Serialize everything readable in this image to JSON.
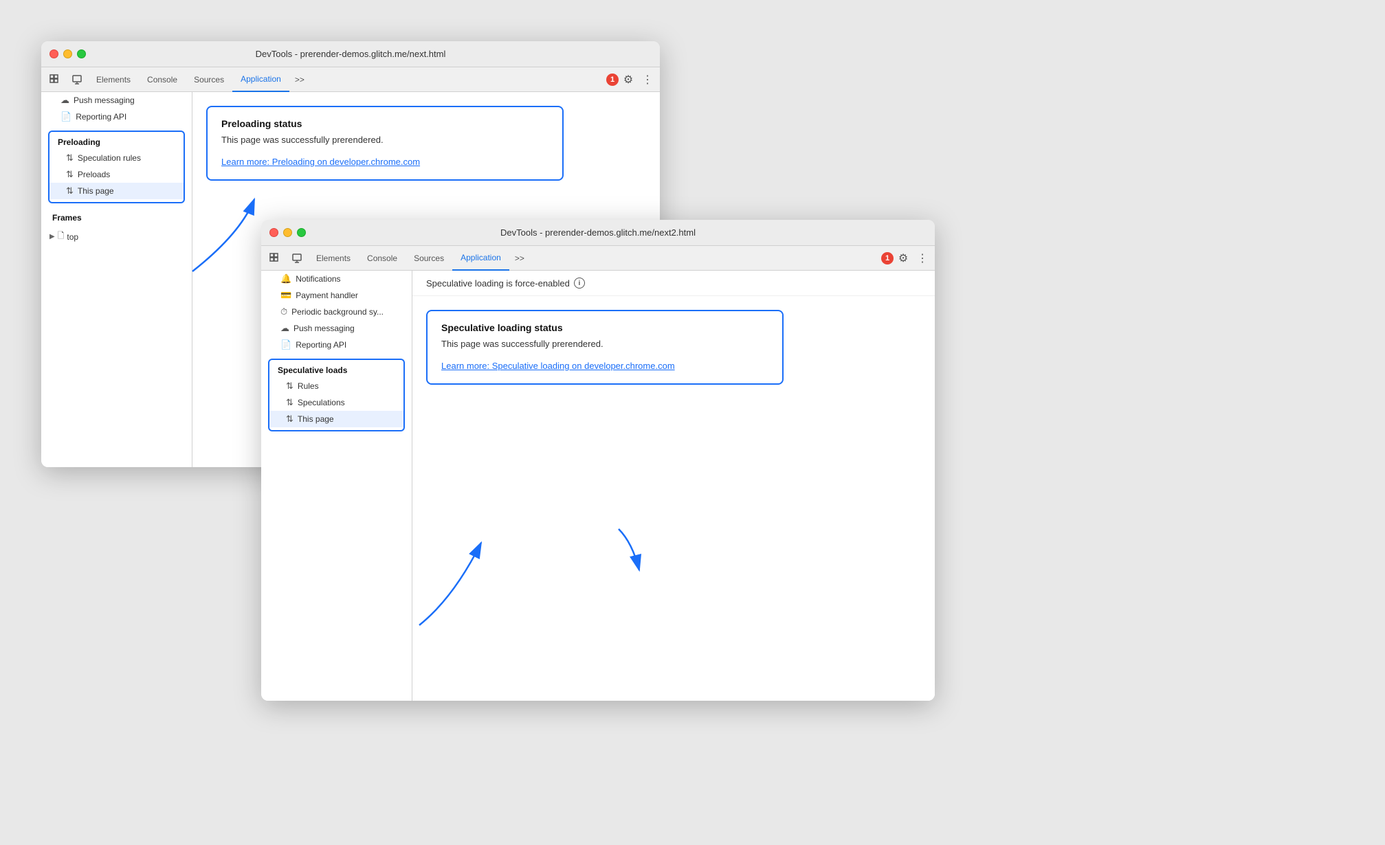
{
  "window1": {
    "title": "DevTools - prerender-demos.glitch.me/next.html",
    "tabs": [
      {
        "label": "Elements",
        "active": false
      },
      {
        "label": "Console",
        "active": false
      },
      {
        "label": "Sources",
        "active": false
      },
      {
        "label": "Application",
        "active": true
      }
    ],
    "tab_more": ">>",
    "error_count": "1",
    "sidebar": {
      "sidebar_items_above": [
        {
          "icon": "☁",
          "label": "Push messaging"
        },
        {
          "icon": "📄",
          "label": "Reporting API"
        }
      ],
      "preloading_header": "Preloading",
      "preloading_items": [
        {
          "icon": "⇅",
          "label": "Speculation rules",
          "selected": false
        },
        {
          "icon": "⇅",
          "label": "Preloads",
          "selected": false
        },
        {
          "icon": "⇅",
          "label": "This page",
          "selected": true
        }
      ],
      "frames_header": "Frames",
      "frames_top": "top"
    },
    "main": {
      "preloading_status_title": "Preloading status",
      "preloading_status_desc": "This page was successfully prerendered.",
      "preloading_status_link": "Learn more: Preloading on developer.chrome.com"
    }
  },
  "window2": {
    "title": "DevTools - prerender-demos.glitch.me/next2.html",
    "tabs": [
      {
        "label": "Elements",
        "active": false
      },
      {
        "label": "Console",
        "active": false
      },
      {
        "label": "Sources",
        "active": false
      },
      {
        "label": "Application",
        "active": true
      }
    ],
    "tab_more": ">>",
    "error_count": "1",
    "sidebar": {
      "sidebar_items": [
        {
          "icon": "🔔",
          "label": "Notifications"
        },
        {
          "icon": "💳",
          "label": "Payment handler"
        },
        {
          "icon": "⏱",
          "label": "Periodic background sy..."
        },
        {
          "icon": "☁",
          "label": "Push messaging"
        },
        {
          "icon": "📄",
          "label": "Reporting API"
        }
      ],
      "spec_loads_header": "Speculative loads",
      "spec_loads_items": [
        {
          "icon": "⇅",
          "label": "Rules",
          "selected": false
        },
        {
          "icon": "⇅",
          "label": "Speculations",
          "selected": false
        },
        {
          "icon": "⇅",
          "label": "This page",
          "selected": true
        }
      ]
    },
    "info_bar": {
      "text": "Speculative loading is force-enabled",
      "icon": "i"
    },
    "main": {
      "spec_status_title": "Speculative loading status",
      "spec_status_desc": "This page was successfully prerendered.",
      "spec_status_link": "Learn more: Speculative loading on developer.chrome.com"
    }
  },
  "icons": {
    "cursor": "⊹",
    "inspector": "⊡",
    "gear": "⚙",
    "dots": "⋮",
    "arrow_updown": "⇅",
    "chevron_right": "▶"
  }
}
